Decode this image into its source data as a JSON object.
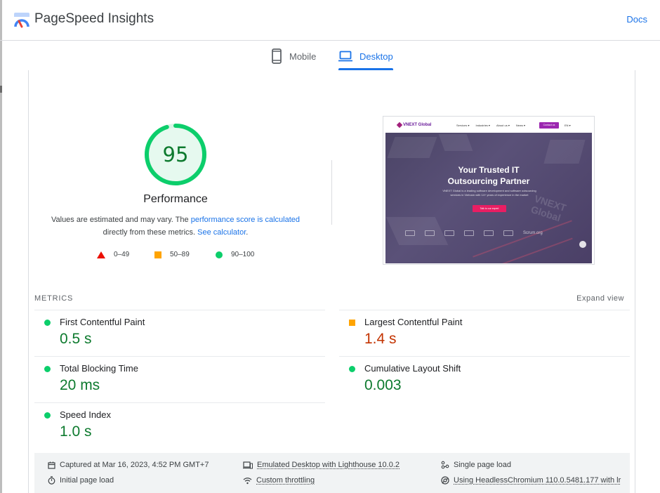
{
  "app": {
    "title": "PageSpeed Insights",
    "docs_label": "Docs"
  },
  "tabs": [
    {
      "label": "Mobile",
      "icon": "smartphone-icon",
      "active": false
    },
    {
      "label": "Desktop",
      "icon": "laptop-icon",
      "active": true
    }
  ],
  "score": {
    "value": "95",
    "fraction": 0.95,
    "label": "Performance",
    "note_prefix": "Values are estimated and may vary. The ",
    "note_link1": "performance score is calculated",
    "note_middle": " directly from these metrics. ",
    "note_link2": "See calculator",
    "note_suffix": "."
  },
  "legend": [
    {
      "range": "0–49",
      "shape": "triangle",
      "color": "#eb0f00"
    },
    {
      "range": "50–89",
      "shape": "square",
      "color": "#ffa400"
    },
    {
      "range": "90–100",
      "shape": "circle",
      "color": "#0cce6b"
    }
  ],
  "page_screenshot": {
    "brand": "VNEXT Global",
    "menu": [
      "Services ▾",
      "Industries ▾",
      "About us ▾",
      "News ▾"
    ],
    "contact_label": "Contact us",
    "lang": "EN ▾",
    "headline_1": "Your Trusted IT",
    "headline_2": "Outsourcing Partner",
    "subtext": "VNEXT Global is a leading software development and software outsourcing services in Vietnam with 14+ years of experience in the market",
    "cta_label": "Talk to our expert",
    "watermark": "VNEXT Global",
    "partner_logo": "Scrum.org"
  },
  "metrics": {
    "title": "METRICS",
    "expand_label": "Expand view",
    "items": [
      {
        "label": "First Contentful Paint",
        "value": "0.5 s",
        "rating": "pass"
      },
      {
        "label": "Largest Contentful Paint",
        "value": "1.4 s",
        "rating": "average"
      },
      {
        "label": "Total Blocking Time",
        "value": "20 ms",
        "rating": "pass"
      },
      {
        "label": "Cumulative Layout Shift",
        "value": "0.003",
        "rating": "pass"
      },
      {
        "label": "Speed Index",
        "value": "1.0 s",
        "rating": "pass"
      }
    ]
  },
  "footer": {
    "captured": "Captured at Mar 16, 2023, 4:52 PM GMT+7",
    "initial_load": "Initial page load",
    "emulated": "Emulated Desktop with Lighthouse 10.0.2",
    "throttling": "Custom throttling",
    "single_load": "Single page load",
    "browser": "Using HeadlessChromium 110.0.5481.177 with lr"
  },
  "colors": {
    "accent": "#1a73e8",
    "pass": "#0cce6b",
    "pass_text": "#0d7a2e",
    "average": "#ffa400",
    "average_text": "#c33300",
    "fail": "#eb0f00"
  }
}
